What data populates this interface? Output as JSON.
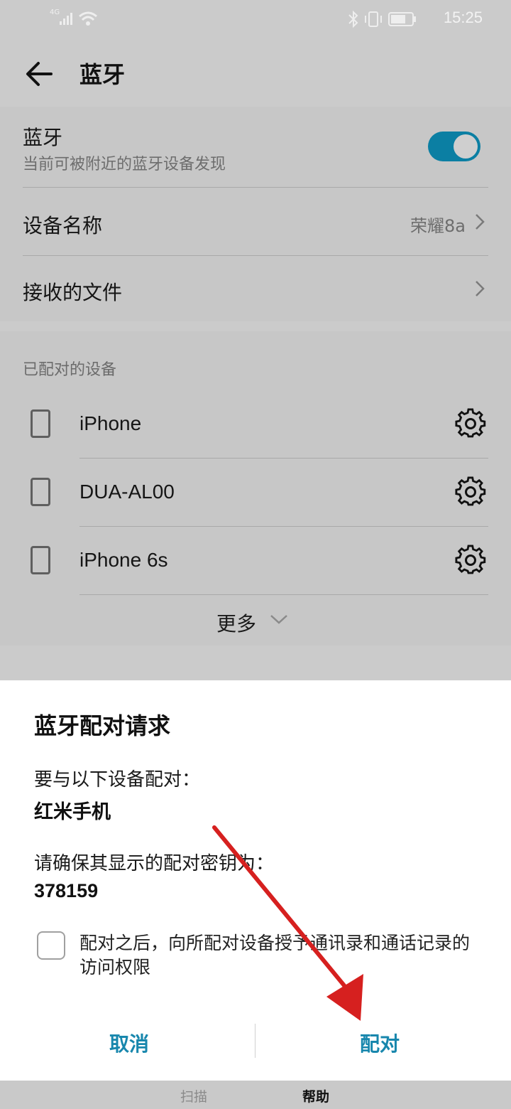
{
  "status_bar": {
    "signal": "4G",
    "time": "15:25"
  },
  "header": {
    "title": "蓝牙"
  },
  "bluetooth": {
    "label": "蓝牙",
    "subtitle": "当前可被附近的蓝牙设备发现",
    "enabled": true
  },
  "device_name": {
    "label": "设备名称",
    "value": "荣耀8a"
  },
  "received_files": {
    "label": "接收的文件"
  },
  "paired": {
    "section_title": "已配对的设备",
    "devices": [
      "iPhone",
      "DUA-AL00",
      "iPhone 6s"
    ],
    "more_label": "更多"
  },
  "dialog": {
    "title": "蓝牙配对请求",
    "prompt": "要与以下设备配对：",
    "device": "红米手机",
    "key_prompt": "请确保其显示的配对密钥为：",
    "key": "378159",
    "permission_text": "配对之后，向所配对设备授予通讯录和通话记录的访问权限",
    "permission_checked": false,
    "cancel_label": "取消",
    "pair_label": "配对"
  },
  "bottom_bar": {
    "scan_label": "扫描",
    "help_label": "帮助"
  },
  "colors": {
    "accent": "#1887ad",
    "toggle": "#0b7fa3",
    "arrow": "#d6201f"
  }
}
